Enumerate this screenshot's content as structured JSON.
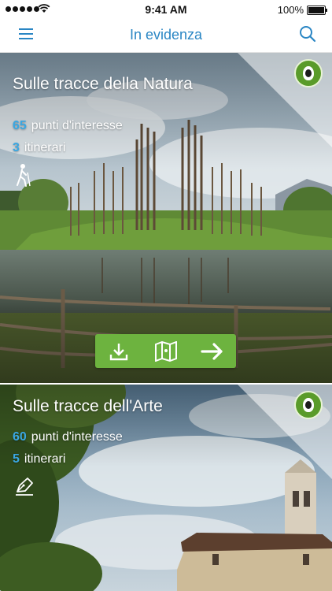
{
  "status_bar": {
    "time": "9:41 AM",
    "battery": "100%"
  },
  "header": {
    "title": "In evidenza",
    "menu_icon": "hamburger-icon",
    "search_icon": "search-icon"
  },
  "cards": [
    {
      "title": "Sulle tracce della Natura",
      "poi_count": "65",
      "poi_label": "punti d'interesse",
      "routes_count": "3",
      "routes_label": "itinerari",
      "category_icon": "hiking-icon",
      "actions": [
        "download-icon",
        "map-icon",
        "arrow-right-icon"
      ]
    },
    {
      "title": "Sulle tracce dell'Arte",
      "poi_count": "60",
      "poi_label": "punti d'interesse",
      "routes_count": "5",
      "routes_label": "itinerari",
      "category_icon": "pen-icon"
    }
  ],
  "colors": {
    "accent": "#2a86c4",
    "count": "#3aa7e2",
    "action_green": "#6db33f"
  }
}
